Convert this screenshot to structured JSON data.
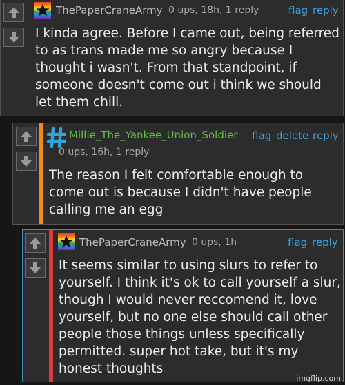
{
  "comments": [
    {
      "author": "ThePaperCraneArmy",
      "meta": "0 ups, 18h, 1 reply",
      "actions": {
        "flag": "flag",
        "reply": "reply"
      },
      "avatar_icon": "rainbow-star-avatar",
      "text": "I kinda agree. Before I came out, being referred\nto as trans made me so angry because I\nthought i wasn't. From that standpoint, if\nsomeone doesn't come out i think we should\nlet them chill."
    },
    {
      "author": "Millie_The_Yankee_Union_Soldier",
      "meta": "0 ups, 16h, 1 reply",
      "actions": {
        "flag": "flag",
        "delete": "delete",
        "reply": "reply"
      },
      "avatar_icon": "hashtag-avatar",
      "accent_color": "#f28c1c",
      "author_color": "#5fbf3f",
      "text": "The reason I felt comfortable enough to\ncome out is because I didn't have people\ncalling me an egg"
    },
    {
      "author": "ThePaperCraneArmy",
      "meta": "0 ups, 1h",
      "actions": {
        "flag": "flag",
        "reply": "reply"
      },
      "avatar_icon": "rainbow-star-avatar",
      "accent_color": "#e03a3a",
      "text": "It seems similar to using slurs to refer to\nyourself. I think it's ok to call yourself a slur,\nthough I would never reccomend it, love\nyourself, but no one else should call other\npeople those things unless specifically\npermitted. super hot take, but it's my\nhonest thoughts"
    }
  ],
  "watermark": "imgflip.com"
}
